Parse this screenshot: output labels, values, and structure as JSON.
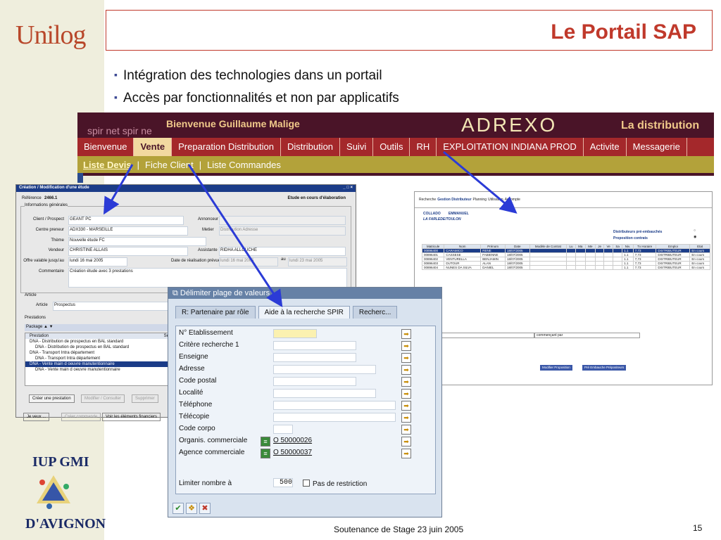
{
  "header": {
    "logo": "Unilog",
    "title": "Le Portail SAP"
  },
  "bullets": [
    "Intégration des technologies dans un portail",
    "Accès par fonctionnalités et non par applicatifs"
  ],
  "portal": {
    "brand": "spir net spir ne",
    "welcome": "Bienvenue Guillaume Malige",
    "logo": "ADREXO",
    "tagline": "La distribution",
    "nav": [
      "Bienvenue",
      "Vente",
      "Preparation Distribution",
      "Distribution",
      "Suivi",
      "Outils",
      "RH",
      "EXPLOITATION INDIANA PROD",
      "Activite",
      "Messagerie"
    ],
    "nav_active": "Vente",
    "subnav": [
      "Liste Devis",
      "Fiche Client",
      "Liste Commandes"
    ],
    "subnav_active": "Liste Devis"
  },
  "win1": {
    "title": "Création / Modification d'une étude",
    "reference_label": "Référence",
    "reference": "2466.1",
    "status": "Etude en cours d'élaboration",
    "section_general": "Informations générales",
    "fields": [
      {
        "label": "Client / Prospect",
        "value": "GEANT PC"
      },
      {
        "label": "Centre preneur",
        "value": "ADX330 - MARSEILLE"
      },
      {
        "label": "Thème",
        "value": "Nouvelle étude FC"
      },
      {
        "label": "Vendeur",
        "value": "CHRISTINE ALLAIS"
      },
      {
        "label": "Offre valable jusqu'au",
        "value": "lundi 16 mai 2005"
      },
      {
        "label": "Commentaire",
        "value": "Création étude avec 3 prestations"
      }
    ],
    "right_fields": [
      {
        "label": "Annonceur",
        "value": ""
      },
      {
        "label": "Metier",
        "value": "Distribution Adresse"
      },
      {
        "label": "Assistante",
        "value": "RIDHA ALLOUCHE"
      }
    ],
    "date_label": "Date de réalisation prévue",
    "date_from": "lundi 16 mai 2005",
    "date_au": "au",
    "date_to": "lundi 23 mai 2005",
    "section_article": "Article",
    "article_label": "Article",
    "article_value": "Prospectus",
    "section_prestations": "Prestations",
    "package": "Package",
    "col_prestation": "Prestation",
    "col_selection": "Sélectio",
    "rows": [
      "DNA - Distribution de prospectus en BAL standard",
      "DNA - Distribution de prospectus en BAL standard",
      "DNA - Transport Intra département",
      "DNA - Transport Intra département",
      "DNA - Vente main d oeuvre manutentionnaire",
      "DNA - Vente main d oeuvre manutentionnaire"
    ],
    "buttons": [
      "Créer une prestation",
      "Modifier / Consulter",
      "Supprimer"
    ],
    "bottom_buttons": [
      "Je veux ...",
      "Créer commande",
      "Voir les éléments financiers"
    ]
  },
  "win2": {
    "tabs": [
      "Recherche",
      "Gestion Distributeur",
      "Planning",
      "Utilisation",
      "Accompte"
    ],
    "name1": "COLLADO",
    "name2": "EMMANUEL",
    "city": "LA FARLEDE/TOULON",
    "opt1": "Distributeurs pré-embauchés",
    "opt2": "Proposition contrats",
    "headers": [
      "Matricule",
      "Nom",
      "Prénom",
      "Date",
      "Modèle de Contrat",
      "Lu",
      "Ma",
      "Me",
      "Je",
      "Ve",
      "Sa",
      "Niv.",
      "Tx Horaire",
      "Emploi",
      "Etat"
    ],
    "rows": [
      [
        "00896400",
        "CARAMICO",
        "RENE",
        "18/07/2005",
        "",
        "",
        "",
        "",
        "",
        "",
        "",
        "1.1",
        "7,73",
        "DISTRIBUTEUR",
        "En cours"
      ],
      [
        "00896401",
        "CASSESE",
        "FABIENNE",
        "18/07/2005",
        "",
        "",
        "",
        "",
        "",
        "",
        "",
        "1.1",
        "7,73",
        "DISTRIBUTEUR",
        "En cours"
      ],
      [
        "00896402",
        "VENTURELLA",
        "BENJAMIN",
        "18/07/2005",
        "",
        "",
        "",
        "",
        "",
        "",
        "",
        "1.1",
        "7,73",
        "DISTRIBUTEUR",
        "En cours"
      ],
      [
        "00896403",
        "DUTOUR",
        "ALAN",
        "18/07/2005",
        "",
        "",
        "",
        "",
        "",
        "",
        "",
        "1.1",
        "7,73",
        "DISTRIBUTEUR",
        "En cours"
      ],
      [
        "00896404",
        "NUNES DA SILVA",
        "DANIEL",
        "18/07/2005",
        "",
        "",
        "",
        "",
        "",
        "",
        "",
        "1.1",
        "7,73",
        "DISTRIBUTEUR",
        "En cours"
      ]
    ],
    "filter1": "Nom",
    "filter2": "commençant par",
    "btn1": "Modifier Proposition",
    "btn2": "Pré Embauche Prépositeurs"
  },
  "win3": {
    "title": "Délimiter plage de valeurs",
    "tabs": [
      "R: Partenaire par rôle",
      "Aide à la recherche SPIR",
      "Recherc..."
    ],
    "fields": [
      "N° Etablissement",
      "Critère recherche 1",
      "Enseigne",
      "Adresse",
      "Code postal",
      "Localité",
      "Téléphone",
      "Télécopie",
      "Code corpo",
      "Organis. commerciale",
      "Agence commerciale"
    ],
    "org_value": "O 50000026",
    "agence_value": "O 50000037",
    "limit_label": "Limiter nombre à",
    "limit_value": "500",
    "norestrict": "Pas de restriction"
  },
  "footer": {
    "text": "Soutenance de Stage 23 juin 2005",
    "page": "15"
  },
  "school": {
    "line1": "IUP GMI",
    "line2": "D'AVIGNON"
  },
  "colors": {
    "accent": "#c0392b",
    "nav": "#a4282b",
    "band": "#4a1428",
    "sub": "#b3a23a",
    "arrow": "#2b3bd6"
  }
}
